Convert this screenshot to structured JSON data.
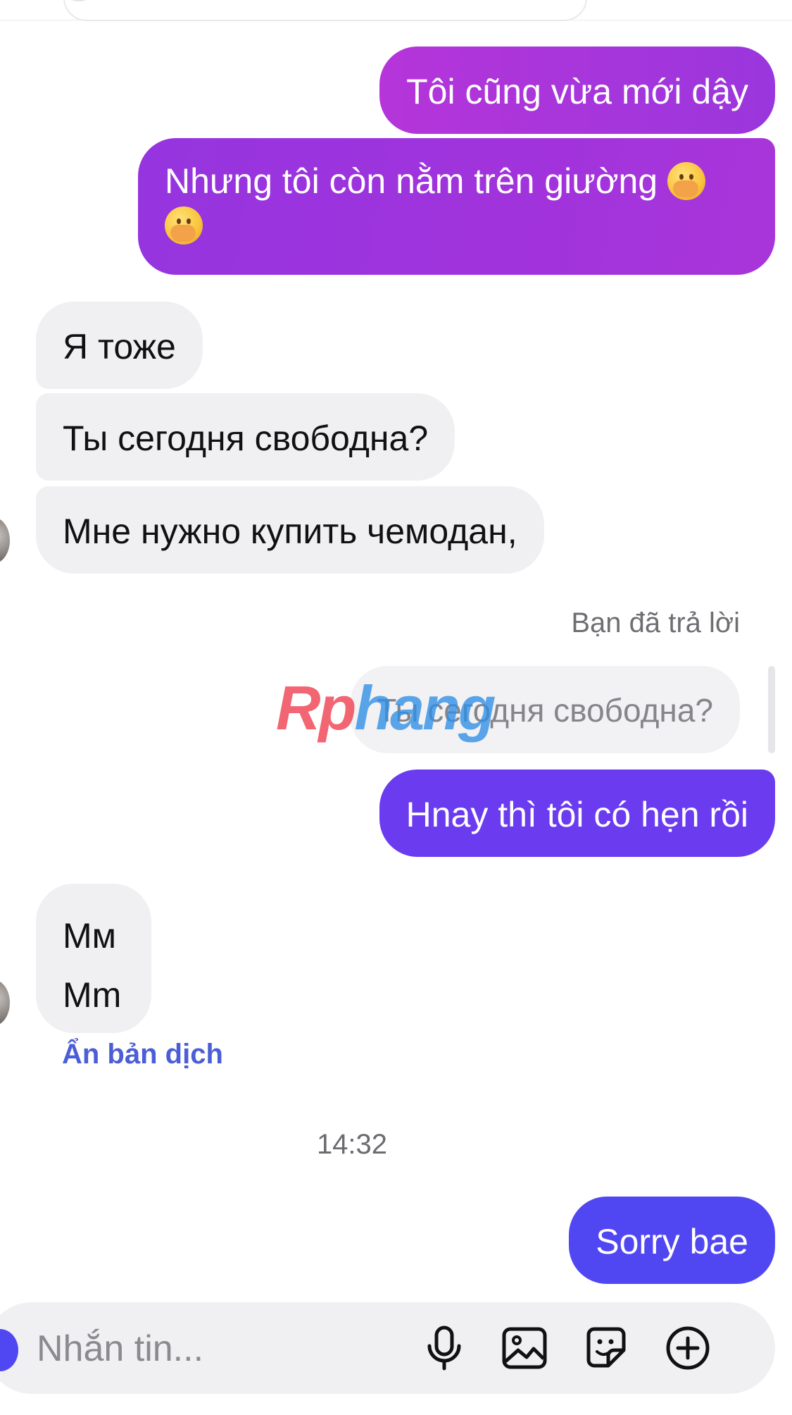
{
  "messages": [
    {
      "id": "b1",
      "dir": "out",
      "text": "Tôi cũng vừa mới dậy"
    },
    {
      "id": "b2",
      "dir": "out",
      "text": "Nhưng tôi còn nằm trên giường"
    },
    {
      "id": "b3",
      "dir": "in",
      "text": "Я тоже"
    },
    {
      "id": "b4",
      "dir": "in",
      "text": "Ты сегодня свободна?"
    },
    {
      "id": "b5",
      "dir": "in",
      "text": "Мне нужно купить чемодан,"
    },
    {
      "id": "b6",
      "dir": "out",
      "text": "Hnay thì tôi có hẹn rồi"
    },
    {
      "id": "b7",
      "dir": "in",
      "text": "Мм",
      "translation": "Mm"
    },
    {
      "id": "b8",
      "dir": "out",
      "text": "Sorry bae"
    }
  ],
  "reply": {
    "label": "Bạn đã trả lời",
    "quoted_text": "Ты сегодня свободна?"
  },
  "hide_translation_label": "Ẩn bản dịch",
  "timestamp": "14:32",
  "watermark": {
    "part1": "Rp",
    "part2": "hang"
  },
  "composer": {
    "placeholder": "Nhắn tin..."
  },
  "icons": {
    "mic": "microphone-icon",
    "image": "image-icon",
    "sticker": "sticker-icon",
    "add": "plus-circle-icon",
    "emoji": "face-with-hand-over-mouth-emoji"
  },
  "colors": {
    "bubble_out_purple": "#a535db",
    "bubble_out_violet": "#6b3bf0",
    "bubble_out_blue": "#5147f2",
    "bubble_in": "#f0f0f2",
    "link_blue": "#4b5ed6"
  }
}
